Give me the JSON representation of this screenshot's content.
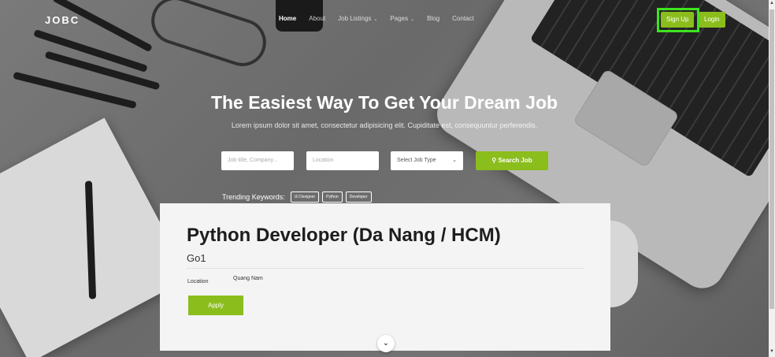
{
  "nav": {
    "logo": "JOBC",
    "items": [
      "Home",
      "About",
      "Job Listings",
      "Pages",
      "Blog",
      "Contact"
    ],
    "signup": "Sign Up",
    "login": "Login"
  },
  "hero": {
    "title": "The Easiest Way To Get Your Dream Job",
    "subtitle": "Lorem ipsum dolor sit amet, consectetur adipisicing elit. Cupiditate est, consequuntur perferendis."
  },
  "search": {
    "job_placeholder": "Job title, Company...",
    "location_placeholder": "Location",
    "job_type": "Select Job Type",
    "button": "Search Job"
  },
  "trending": {
    "label": "Trending Keywords:",
    "tags": [
      "UI Designer",
      "Python",
      "Developer"
    ]
  },
  "job": {
    "title": "Python Developer (Da Nang / HCM)",
    "company": "Go1",
    "location_label": "Location",
    "location_value": "Quang Nam",
    "apply": "Apply"
  },
  "colors": {
    "accent": "#8bbd1c",
    "highlight": "#3ee41e"
  },
  "icons": {
    "search": "search-icon",
    "down": "chevron-down-icon"
  }
}
